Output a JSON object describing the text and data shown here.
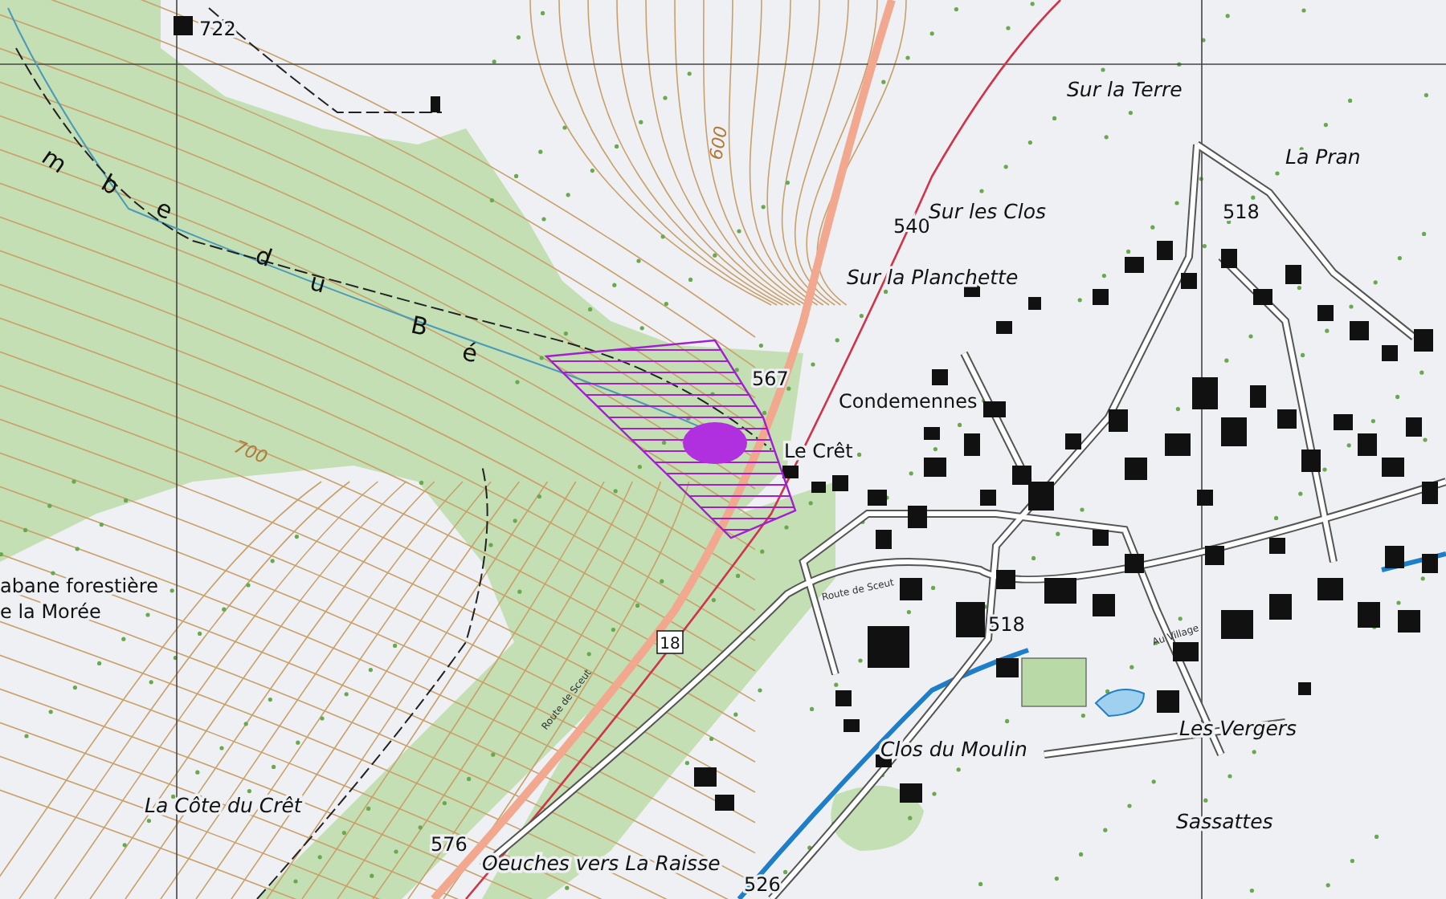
{
  "map": {
    "place_labels": [
      {
        "kind": "locality",
        "text": "Sur la Terre"
      },
      {
        "kind": "locality",
        "text": "La Pran"
      },
      {
        "kind": "locality",
        "text": "Sur les Clos"
      },
      {
        "kind": "locality",
        "text": "Sur la Planchette"
      },
      {
        "kind": "name",
        "text": "Condemennes"
      },
      {
        "kind": "name",
        "text": "Le Crêt"
      },
      {
        "kind": "name",
        "text": "abane forestière"
      },
      {
        "kind": "name",
        "text": "e la Morée"
      },
      {
        "kind": "locality",
        "text": "La Côte du Crêt"
      },
      {
        "kind": "locality",
        "text": "Clos du Moulin"
      },
      {
        "kind": "locality",
        "text": "Les Vergers"
      },
      {
        "kind": "locality",
        "text": "Sassattes"
      },
      {
        "kind": "locality",
        "text": "Oeuches vers La Raisse"
      }
    ],
    "spot_heights": [
      "722",
      "518",
      "540",
      "567",
      "518",
      "576",
      "526"
    ],
    "contour_labels": [
      "600",
      "700"
    ],
    "stream_letters": [
      "m",
      "b",
      "e",
      "d",
      "u",
      "B",
      "é"
    ],
    "road_number": "18",
    "street_names": [
      "Route de Sceut",
      "Route de Sceut",
      "Au Village"
    ]
  }
}
